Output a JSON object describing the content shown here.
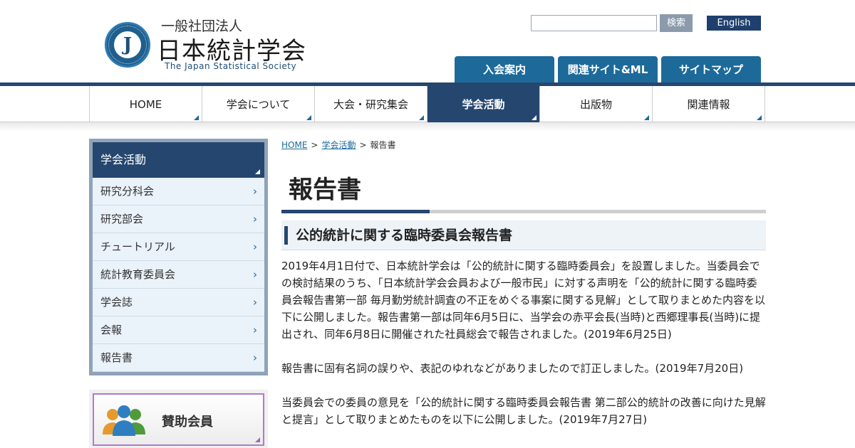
{
  "header": {
    "logo_sub": "一般社団法人",
    "logo_title": "日本統計学会",
    "logo_en": "The Japan Statistical Society",
    "search_placeholder": "",
    "search_button": "検索",
    "english_button": "English",
    "util_tabs": [
      "入会案内",
      "関連サイト&ML",
      "サイトマップ"
    ]
  },
  "nav": {
    "items": [
      "HOME",
      "学会について",
      "大会・研究集会",
      "学会活動",
      "出版物",
      "関連情報"
    ],
    "active": "学会活動"
  },
  "sidebar": {
    "heading": "学会活動",
    "items": [
      "研究分科会",
      "研究部会",
      "チュートリアル",
      "統計教育委員会",
      "学会誌",
      "会報",
      "報告書"
    ]
  },
  "sponsor": {
    "label": "賛助会員"
  },
  "breadcrumb": {
    "home": "HOME",
    "parent": "学会活動",
    "sep": ">",
    "current": "報告書"
  },
  "page": {
    "title": "報告書",
    "section_heading": "公的統計に関する臨時委員会報告書",
    "paragraphs": [
      "2019年4月1日付で、日本統計学会は「公的統計に関する臨時委員会」を設置しました。当委員会での検討結果のうち、「日本統計学会会員および一般市民」に対する声明を「公的統計に関する臨時委員会報告書第一部 毎月勤労統計調査の不正をめぐる事案に関する見解」として取りまとめた内容を以下に公開しました。報告書第一部は同年6月5日に、当学会の赤平会長(当時)と西郷理事長(当時)に提出され、同年6月8日に開催された社員総会で報告されました。(2019年6月25日)",
      "報告書に固有名詞の誤りや、表記のゆれなどがありましたので訂正しました。(2019年7月20日)",
      "当委員会での委員の意見を「公的統計に関する臨時委員会報告書 第二部公的統計の改善に向けた見解と提言」として取りまとめたものを以下に公開しました。(2019年7月27日)"
    ]
  },
  "colors": {
    "navy": "#25476f",
    "blue": "#1d6a9a",
    "sidebar_bg": "#8fa3b8"
  }
}
